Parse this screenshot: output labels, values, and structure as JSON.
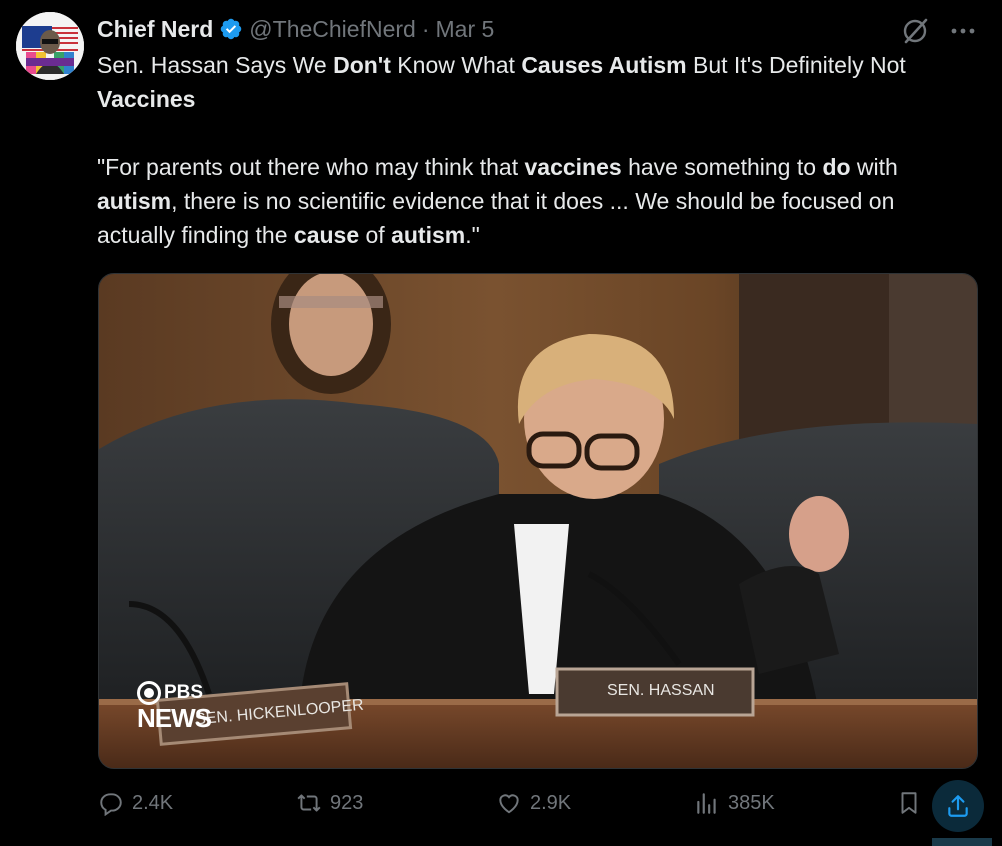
{
  "author": {
    "name": "Chief Nerd",
    "handle": "@TheChiefNerd",
    "separator": "·",
    "date": "Mar 5",
    "avatar_text": "CHIEF NERD"
  },
  "tweet": {
    "headline_parts": [
      {
        "t": "Sen. Hassan Says We ",
        "b": false
      },
      {
        "t": "Don't",
        "b": true
      },
      {
        "t": " Know What ",
        "b": false
      },
      {
        "t": "Causes Autism",
        "b": true
      },
      {
        "t": " But It's Definitely Not ",
        "b": false
      },
      {
        "t": "Vaccines",
        "b": true
      }
    ],
    "quote_parts": [
      {
        "t": "\"For parents out there who may think that ",
        "b": false
      },
      {
        "t": "vaccines",
        "b": true
      },
      {
        "t": " have something to ",
        "b": false
      },
      {
        "t": "do",
        "b": true
      },
      {
        "t": " with ",
        "b": false
      },
      {
        "t": "autism",
        "b": true
      },
      {
        "t": ", there is no scientific evidence that it does ... We should be focused on actually finding the ",
        "b": false
      },
      {
        "t": "cause",
        "b": true
      },
      {
        "t": " of ",
        "b": false
      },
      {
        "t": "autism",
        "b": true
      },
      {
        "t": ".\"",
        "b": false
      }
    ]
  },
  "media": {
    "pbs_top": "PBS",
    "pbs_bottom": "NEWS",
    "nameplate_left": "SEN. HICKENLOOPER",
    "nameplate_center": "SEN. HASSAN"
  },
  "actions": {
    "replies": "2.4K",
    "reposts": "923",
    "likes": "2.9K",
    "views": "385K"
  },
  "colors": {
    "background": "#000000",
    "text": "#e7e9ea",
    "muted": "#71767b",
    "verified": "#1d9bf0",
    "share": "#1d9bf0"
  }
}
